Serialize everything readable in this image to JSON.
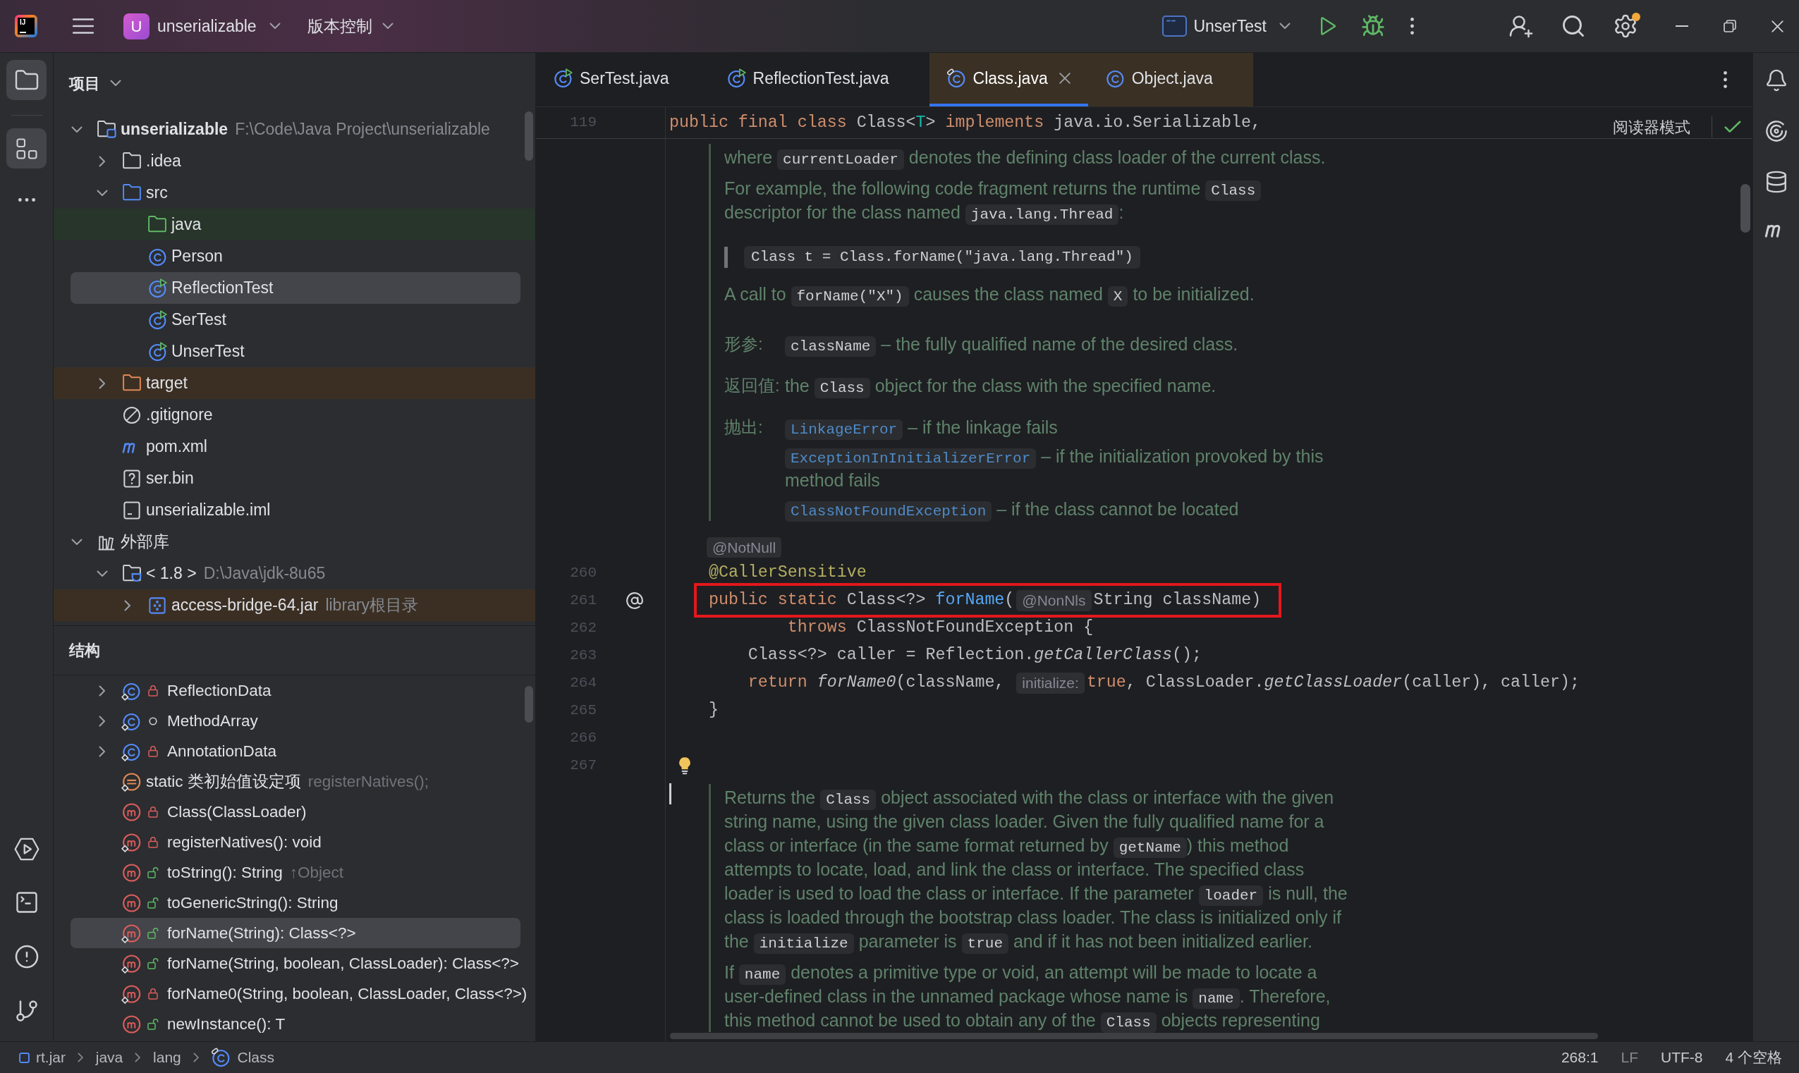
{
  "title_bar": {
    "logo": "IJ",
    "project_badge": "U",
    "project": "unserializable",
    "vcs_menu": "版本控制",
    "run_config": "UnserTest",
    "settings_badge": true
  },
  "tool_windows": [
    {
      "kind": "project",
      "selected": true
    },
    {
      "kind": "structure",
      "selected": true
    }
  ],
  "project_panel": {
    "title": "项目",
    "tree": [
      {
        "kind": "module",
        "label": "unserializable",
        "detail": "F:\\Code\\Java Project\\unserializable",
        "expanded": true,
        "selected": false,
        "children": [
          {
            "kind": "folder",
            "label": ".idea",
            "expanded": false,
            "selected": false
          },
          {
            "kind": "source_root",
            "label": "src",
            "expanded": true,
            "selected": false,
            "children": [
              {
                "kind": "test_root",
                "label": "java",
                "selected": false,
                "color": "#27352a"
              },
              {
                "kind": "class",
                "label": "Person",
                "selected": false
              },
              {
                "kind": "test_class",
                "label": "ReflectionTest",
                "selected": true
              },
              {
                "kind": "test_class",
                "label": "SerTest",
                "selected": false
              },
              {
                "kind": "test_class",
                "label": "UnserTest",
                "selected": false
              }
            ]
          },
          {
            "kind": "excluded",
            "label": "target",
            "expanded": false,
            "selected": false,
            "color": "#3b2f24"
          },
          {
            "kind": "ignore_file",
            "label": ".gitignore",
            "selected": false
          },
          {
            "kind": "maven_file",
            "label": "pom.xml",
            "selected": false
          },
          {
            "kind": "unknown_file",
            "label": "ser.bin",
            "selected": false
          },
          {
            "kind": "module_file",
            "label": "unserializable.iml",
            "selected": false
          }
        ]
      },
      {
        "kind": "libraries",
        "label": "外部库",
        "expanded": true,
        "selected": false,
        "children": [
          {
            "kind": "sdk",
            "label": "< 1.8 >",
            "detail": "D:\\Java\\jdk-8u65",
            "expanded": true,
            "selected": false,
            "children": [
              {
                "kind": "jar",
                "label": "access-bridge-64.jar",
                "detail": "library根目录",
                "expanded": false,
                "selected": false,
                "color": "#3b2f24"
              }
            ]
          }
        ]
      }
    ]
  },
  "structure_panel": {
    "title": "结构",
    "items": [
      {
        "kind": "private_class",
        "label": "ReflectionData",
        "static": true,
        "expanded": false,
        "selected": false
      },
      {
        "kind": "package_class",
        "label": "MethodArray",
        "static": true,
        "expanded": false,
        "selected": false
      },
      {
        "kind": "private_class",
        "label": "AnnotationData",
        "static": true,
        "expanded": false,
        "selected": false
      },
      {
        "kind": "initializer",
        "label": "static 类初始值设定项",
        "detail": "registerNatives();",
        "static": true,
        "selected": false
      },
      {
        "kind": "private_method",
        "label": "Class(ClassLoader)",
        "static": false,
        "selected": false
      },
      {
        "kind": "private_method",
        "label": "registerNatives(): void",
        "static": true,
        "selected": false
      },
      {
        "kind": "public_method",
        "label": "toString(): String",
        "detail": "↑Object",
        "static": false,
        "selected": false
      },
      {
        "kind": "public_method",
        "label": "toGenericString(): String",
        "static": false,
        "selected": false
      },
      {
        "kind": "public_method",
        "label": "forName(String): Class<?>",
        "static": true,
        "selected": true
      },
      {
        "kind": "public_method",
        "label": "forName(String, boolean, ClassLoader): Class<?>",
        "static": true,
        "selected": false
      },
      {
        "kind": "private_method",
        "label": "forName0(String, boolean, ClassLoader, Class<?>)",
        "static": true,
        "selected": false
      },
      {
        "kind": "public_method",
        "label": "newInstance(): T",
        "static": false,
        "selected": false
      }
    ]
  },
  "editor": {
    "tabs": [
      {
        "label": "SerTest.java",
        "kind": "test_class",
        "selected": false
      },
      {
        "label": "ReflectionTest.java",
        "kind": "test_class",
        "selected": false
      },
      {
        "label": "Class.java",
        "kind": "library_class",
        "selected": true,
        "color": "#3a3024"
      },
      {
        "label": "Object.java",
        "kind": "class",
        "selected": false,
        "color": "#3a3024"
      }
    ],
    "sticky_line": {
      "number": "119",
      "tokens": [
        {
          "kind": "keyword",
          "text": "public final class"
        },
        {
          "kind": "plain",
          "text": " Class<"
        },
        {
          "kind": "type_param",
          "text": "T"
        },
        {
          "kind": "plain",
          "text": "> "
        },
        {
          "kind": "keyword",
          "text": "implements"
        },
        {
          "kind": "plain",
          "text": " java.io.Serializable,"
        }
      ]
    },
    "reader_mode": "阅读器模式",
    "blocks": [
      {
        "kind": "doc",
        "parts": [
          {
            "kind": "paragraph",
            "lines": [
              [
                {
                  "kind": "text",
                  "text": "where "
                },
                {
                  "kind": "code",
                  "text": "currentLoader"
                },
                {
                  "kind": "text",
                  "text": " denotes the defining class loader of the current class."
                }
              ]
            ]
          },
          {
            "kind": "paragraph",
            "lines": [
              [
                {
                  "kind": "text",
                  "text": "For example, the following code fragment returns the runtime "
                },
                {
                  "kind": "code",
                  "text": "Class"
                }
              ],
              [
                {
                  "kind": "text",
                  "text": "descriptor for the class named "
                },
                {
                  "kind": "code",
                  "text": "java.lang.Thread"
                },
                {
                  "kind": "text",
                  "text": ":"
                }
              ]
            ]
          },
          {
            "kind": "pre",
            "text": "Class t = Class.forName(\"java.lang.Thread\")"
          },
          {
            "kind": "paragraph",
            "lines": [
              [
                {
                  "kind": "text",
                  "text": "A call to "
                },
                {
                  "kind": "code",
                  "text": "forName(\"X\")"
                },
                {
                  "kind": "text",
                  "text": " causes the class named "
                },
                {
                  "kind": "code",
                  "text": "X"
                },
                {
                  "kind": "text",
                  "text": " to be initialized."
                }
              ]
            ]
          },
          {
            "kind": "tags",
            "sections": [
              {
                "label": "形参:",
                "entries": [
                  {
                    "lines": [
                      [
                        {
                          "kind": "code",
                          "text": "className"
                        },
                        {
                          "kind": "text",
                          "text": " – the fully qualified name of the desired class."
                        }
                      ]
                    ]
                  }
                ]
              },
              {
                "label": "返回值:",
                "entries": [
                  {
                    "lines": [
                      [
                        {
                          "kind": "text",
                          "text": "the "
                        },
                        {
                          "kind": "code",
                          "text": "Class"
                        },
                        {
                          "kind": "text",
                          "text": " object for the class with the specified name."
                        }
                      ]
                    ]
                  }
                ]
              },
              {
                "label": "抛出:",
                "entries": [
                  {
                    "lines": [
                      [
                        {
                          "kind": "link",
                          "text": "LinkageError"
                        },
                        {
                          "kind": "text",
                          "text": " – if the linkage fails"
                        }
                      ]
                    ]
                  },
                  {
                    "lines": [
                      [
                        {
                          "kind": "link",
                          "text": "ExceptionInInitializerError"
                        },
                        {
                          "kind": "text",
                          "text": " – if the initialization provoked by this"
                        }
                      ],
                      [
                        {
                          "kind": "text",
                          "text": "method fails"
                        }
                      ]
                    ]
                  },
                  {
                    "lines": [
                      [
                        {
                          "kind": "link",
                          "text": "ClassNotFoundException"
                        },
                        {
                          "kind": "text",
                          "text": " – if the class cannot be located"
                        }
                      ]
                    ]
                  }
                ]
              }
            ]
          }
        ]
      },
      {
        "kind": "inlay",
        "text": "@NotNull"
      },
      {
        "kind": "code",
        "number": "260",
        "tokens": [
          {
            "kind": "annotation",
            "text": "    @CallerSensitive"
          }
        ]
      },
      {
        "kind": "code",
        "number": "261",
        "highlighted": true,
        "annotated": true,
        "tokens": [
          {
            "kind": "keyword",
            "text": "    public static"
          },
          {
            "kind": "plain",
            "text": " Class<?> "
          },
          {
            "kind": "method_decl",
            "text": "forName"
          },
          {
            "kind": "plain",
            "text": "("
          },
          {
            "kind": "hint",
            "text": "@NonNls"
          },
          {
            "kind": "plain",
            "text": "String className)"
          }
        ]
      },
      {
        "kind": "code",
        "number": "262",
        "tokens": [
          {
            "kind": "keyword",
            "text": "            throws"
          },
          {
            "kind": "plain",
            "text": " ClassNotFoundException {"
          }
        ]
      },
      {
        "kind": "code",
        "number": "263",
        "tokens": [
          {
            "kind": "plain",
            "text": "        Class<?> caller = Reflection."
          },
          {
            "kind": "static_call",
            "text": "getCallerClass"
          },
          {
            "kind": "plain",
            "text": "();"
          }
        ]
      },
      {
        "kind": "code",
        "number": "264",
        "tokens": [
          {
            "kind": "keyword",
            "text": "        return "
          },
          {
            "kind": "static_call",
            "text": "forName0"
          },
          {
            "kind": "plain",
            "text": "(className, "
          },
          {
            "kind": "hint",
            "text": "initialize:"
          },
          {
            "kind": "keyword",
            "text": "true"
          },
          {
            "kind": "plain",
            "text": ", ClassLoader."
          },
          {
            "kind": "static_call",
            "text": "getClassLoader"
          },
          {
            "kind": "plain",
            "text": "(caller), caller);"
          }
        ]
      },
      {
        "kind": "code",
        "number": "265",
        "tokens": [
          {
            "kind": "plain",
            "text": "    }"
          }
        ]
      },
      {
        "kind": "code",
        "number": "266"
      },
      {
        "kind": "code",
        "number": "267",
        "intention": true
      },
      {
        "kind": "doc",
        "caret": true,
        "parts": [
          {
            "kind": "paragraph",
            "lines": [
              [
                {
                  "kind": "text",
                  "text": "Returns the "
                },
                {
                  "kind": "code",
                  "text": "Class"
                },
                {
                  "kind": "text",
                  "text": " object associated with the class or interface with the given"
                }
              ],
              [
                {
                  "kind": "text",
                  "text": "string name, using the given class loader. Given the fully qualified name for a"
                }
              ],
              [
                {
                  "kind": "text",
                  "text": "class or interface (in the same format returned by "
                },
                {
                  "kind": "code",
                  "text": "getName"
                },
                {
                  "kind": "text",
                  "text": ") this method"
                }
              ],
              [
                {
                  "kind": "text",
                  "text": "attempts to locate, load, and link the class or interface. The specified class"
                }
              ],
              [
                {
                  "kind": "text",
                  "text": "loader is used to load the class or interface. If the parameter "
                },
                {
                  "kind": "code",
                  "text": "loader"
                },
                {
                  "kind": "text",
                  "text": " is null, the"
                }
              ],
              [
                {
                  "kind": "text",
                  "text": "class is loaded through the bootstrap class loader. The class is initialized only if"
                }
              ],
              [
                {
                  "kind": "text",
                  "text": "the "
                },
                {
                  "kind": "code",
                  "text": "initialize"
                },
                {
                  "kind": "text",
                  "text": " parameter is "
                },
                {
                  "kind": "code",
                  "text": "true"
                },
                {
                  "kind": "text",
                  "text": " and if it has not been initialized earlier."
                }
              ]
            ]
          },
          {
            "kind": "paragraph",
            "lines": [
              [
                {
                  "kind": "text",
                  "text": "If "
                },
                {
                  "kind": "code",
                  "text": "name"
                },
                {
                  "kind": "text",
                  "text": " denotes a primitive type or void, an attempt will be made to locate a"
                }
              ],
              [
                {
                  "kind": "text",
                  "text": "user-defined class in the unnamed package whose name is "
                },
                {
                  "kind": "code",
                  "text": "name"
                },
                {
                  "kind": "text",
                  "text": ". Therefore,"
                }
              ],
              [
                {
                  "kind": "text",
                  "text": "this method cannot be used to obtain any of the "
                },
                {
                  "kind": "code",
                  "text": "Class"
                },
                {
                  "kind": "text",
                  "text": " objects representing"
                }
              ]
            ]
          }
        ]
      }
    ]
  },
  "status_bar": {
    "breadcrumbs": [
      {
        "kind": "jar",
        "label": "rt.jar"
      },
      {
        "kind": "package",
        "label": "java"
      },
      {
        "kind": "package",
        "label": "lang"
      },
      {
        "kind": "class",
        "label": "Class"
      }
    ],
    "position": "268:1",
    "line_separator": "LF",
    "encoding": "UTF-8",
    "indent": "4 个空格"
  }
}
